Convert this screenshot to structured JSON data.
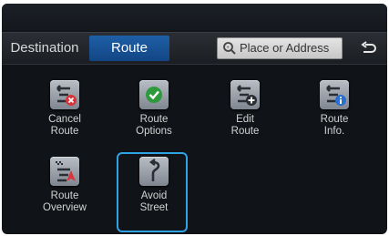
{
  "tabs": [
    {
      "label": "Destination",
      "active": false
    },
    {
      "label": "Route",
      "active": true
    }
  ],
  "search": {
    "placeholder": "Place or Address",
    "icon": "search-icon"
  },
  "back_icon": "back-arrow-icon",
  "menu": [
    {
      "line1": "Cancel",
      "line2": "Route",
      "icon": "cancel-route-icon"
    },
    {
      "line1": "Route",
      "line2": "Options",
      "icon": "route-options-check-icon"
    },
    {
      "line1": "Edit",
      "line2": "Route",
      "icon": "edit-route-icon"
    },
    {
      "line1": "Route",
      "line2": "Info.",
      "icon": "route-info-icon"
    },
    {
      "line1": "Route",
      "line2": "Overview",
      "icon": "route-overview-icon"
    },
    {
      "line1": "Avoid",
      "line2": "Street",
      "icon": "avoid-street-icon",
      "selected": true
    }
  ],
  "colors": {
    "active_tab": "#1e5fa6",
    "selection_outline": "#2fa3e3",
    "cancel_badge": "#d8343a",
    "options_badge": "#2f9a3c",
    "info_badge": "#2a6fd0"
  }
}
